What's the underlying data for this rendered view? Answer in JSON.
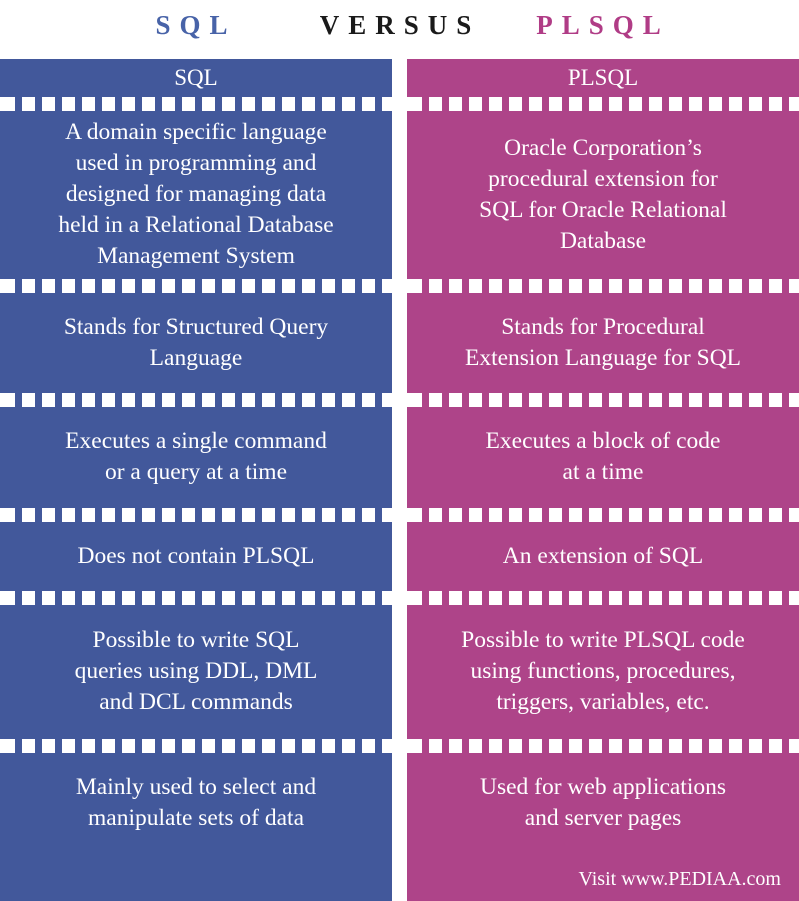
{
  "title": {
    "left": "SQL",
    "middle": "VERSUS",
    "right": "PLSQL"
  },
  "colors": {
    "left_column": "#42589B",
    "right_column": "#AE4489",
    "left_title": "#4863A8",
    "right_title": "#B03C86",
    "middle_title": "#1A1A1A",
    "text": "#FFFFFF",
    "page_background": "#FFFFFF"
  },
  "columns": {
    "left": {
      "header": "SQL",
      "rows": [
        {
          "lines": [
            "A domain specific language",
            "used in programming and",
            "designed for managing data",
            "held in a Relational Database",
            "Management System"
          ]
        },
        {
          "lines": [
            "Stands for Structured Query",
            "Language"
          ]
        },
        {
          "lines": [
            "Executes a single command",
            "or a query at a time"
          ]
        },
        {
          "lines": [
            "Does not contain PLSQL"
          ]
        },
        {
          "lines": [
            "Possible to write SQL",
            "queries using DDL, DML",
            "and DCL commands"
          ]
        },
        {
          "lines": [
            "Mainly used to select and",
            "manipulate sets of data"
          ]
        }
      ]
    },
    "right": {
      "header": "PLSQL",
      "rows": [
        {
          "lines": [
            "Oracle Corporation’s",
            "procedural extension for",
            "SQL for Oracle Relational",
            "Database"
          ]
        },
        {
          "lines": [
            "Stands for Procedural",
            "Extension Language for SQL"
          ]
        },
        {
          "lines": [
            "Executes a block of code",
            "at a time"
          ]
        },
        {
          "lines": [
            "An extension of SQL"
          ]
        },
        {
          "lines": [
            "Possible to write PLSQL code",
            "using functions, procedures,",
            "triggers, variables, etc."
          ]
        },
        {
          "lines": [
            "Used for web applications",
            "and server pages"
          ]
        }
      ]
    }
  },
  "footer": {
    "credit": "Visit www.PEDIAA.com"
  }
}
